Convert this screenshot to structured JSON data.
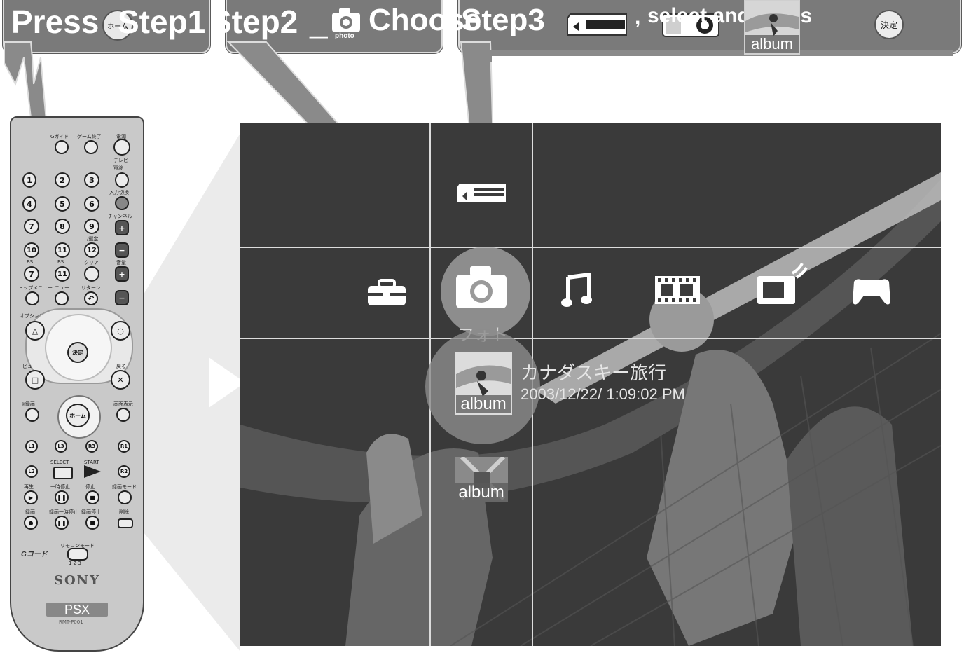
{
  "instructions": {
    "press": "Press",
    "step1": "Step1",
    "step2": "Step2",
    "underscore": "_",
    "choose": "Choose",
    "step3": "Step3",
    "comma": ",",
    "select_and_press": "select and press",
    "photo_icon_caption": "photo",
    "home_button_label": "ホーム",
    "enter_button_label": "決定",
    "album_label": "album"
  },
  "xmb": {
    "categories": [
      {
        "name": "settings",
        "icon": "toolbox-icon"
      },
      {
        "name": "photo",
        "icon": "camera-icon"
      },
      {
        "name": "music",
        "icon": "music-note-icon"
      },
      {
        "name": "video",
        "icon": "film-icon"
      },
      {
        "name": "tv",
        "icon": "tv-icon"
      },
      {
        "name": "game",
        "icon": "gamepad-icon"
      }
    ],
    "selected_category_label": "フォト",
    "items": [
      {
        "thumb_label": "album",
        "title": "カナダスキー旅行",
        "date": "2003/12/22/ 1:09:02 PM"
      },
      {
        "thumb_label": "album"
      }
    ],
    "memory_card_icon": "memory-card-icon"
  },
  "remote": {
    "brand": "SONY",
    "model": "PSX",
    "model_number": "RMT-P001",
    "labels": {
      "g_guide": "Gガイド",
      "game_end": "ゲーム終了",
      "power": "電源",
      "tv_power": "テレビ電源",
      "input_switch": "入力切換",
      "channel": "チャンネル",
      "decide": "/選定",
      "clear": "クリア",
      "volume": "音量",
      "top_menu": "トップメニュー",
      "menu": "ニュー",
      "return": "リターン",
      "option": "オプション",
      "view": "ビュー",
      "back": "戻る",
      "record": "※録画",
      "screen_display": "画面表示",
      "home": "ホーム",
      "enter": "決定",
      "select": "SELECT",
      "start": "START",
      "play": "再生",
      "pause": "一時停止",
      "stop": "停止",
      "rec_mode": "録画モード",
      "rec": "録画",
      "rec_pause": "録画一時停止",
      "rec_stop": "録画停止",
      "delete": "削除",
      "remote_mode": "リモコンモード",
      "g_code": "Gコード",
      "mode_numbers": "1 2 3",
      "bs": "BS",
      "l1": "L1",
      "l2": "L2",
      "l3": "L3",
      "r1": "R1",
      "r2": "R2",
      "r3": "R3"
    },
    "number_keys": [
      "1",
      "2",
      "3",
      "4",
      "5",
      "6",
      "7",
      "8",
      "9",
      "10",
      "11",
      "12"
    ]
  },
  "colors": {
    "callout_bg": "#7a7a7a",
    "callout_border": "#dcdcdc",
    "screen_bg": "#3c3c3c"
  }
}
